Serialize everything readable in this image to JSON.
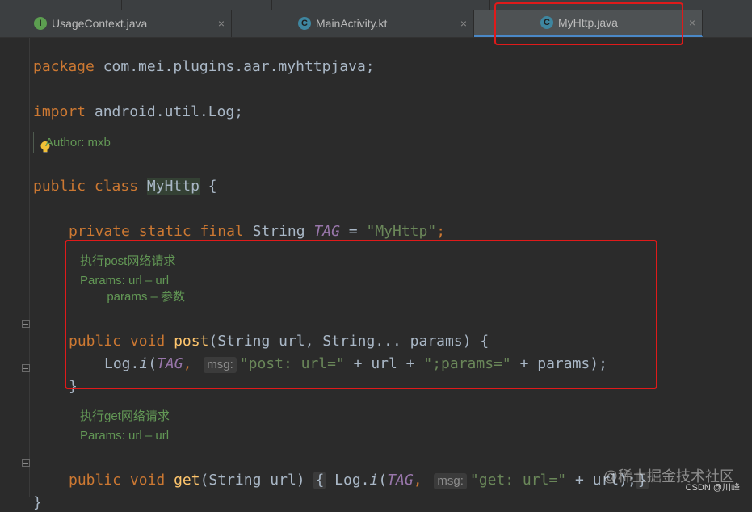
{
  "tabs": [
    {
      "name": "UsageContext.java",
      "icon": "java-interface-icon",
      "active": false
    },
    {
      "name": "MainActivity.kt",
      "icon": "kotlin-class-icon",
      "active": false
    },
    {
      "name": "MyHttp.java",
      "icon": "java-class-icon",
      "active": true
    }
  ],
  "tab_close": "×",
  "code": {
    "package_kw": "package",
    "package_name": " com.mei.plugins.aar.myhttpjava;",
    "import_kw": "import",
    "import_name": " android.util.Log;",
    "class_doc": "Author: mxb",
    "class_kw": "public class",
    "class_name": "MyHttp",
    "class_open": " {",
    "field_kw": "private static final",
    "field_type": " String ",
    "field_name": "TAG",
    "field_eq": " = ",
    "field_value": "\"MyHttp\"",
    "field_semi": ";",
    "post_doc": [
      "执行post网络请求",
      "Params: url – url",
      "        params – 参数"
    ],
    "post_sig_kw": "public void",
    "post_method": "post",
    "post_params": "(String url, String... params) {",
    "post_body_prefix": "Log.",
    "post_body_call": "i",
    "post_body_paren": "(",
    "post_body_tag": "TAG",
    "post_body_comma": ", ",
    "post_hint": "msg:",
    "post_body_str1": "\"post: url=\"",
    "post_body_mid": " + url + ",
    "post_body_str2": "\";params=\"",
    "post_body_end": " + params);",
    "post_close": "}",
    "get_doc": [
      "执行get网络请求",
      "Params: url – url"
    ],
    "get_sig_kw": "public void",
    "get_method": "get",
    "get_params": "(String url) ",
    "get_fold_open": "{",
    "get_body_prefix": " Log.",
    "get_body_call": "i",
    "get_body_paren": "(",
    "get_body_tag": "TAG",
    "get_body_comma": ", ",
    "get_hint": "msg:",
    "get_body_str": "\"get: url=\"",
    "get_body_end": " + url);",
    "get_fold_close": "}",
    "class_close": "}"
  },
  "watermark": "@稀土掘金技术社区",
  "watermark_small": "CSDN @川峰",
  "colors": {
    "keyword": "#cc7832",
    "string": "#6a8759",
    "constant": "#9876aa",
    "method": "#ffc66d",
    "highlight_box": "#e01a1a"
  }
}
